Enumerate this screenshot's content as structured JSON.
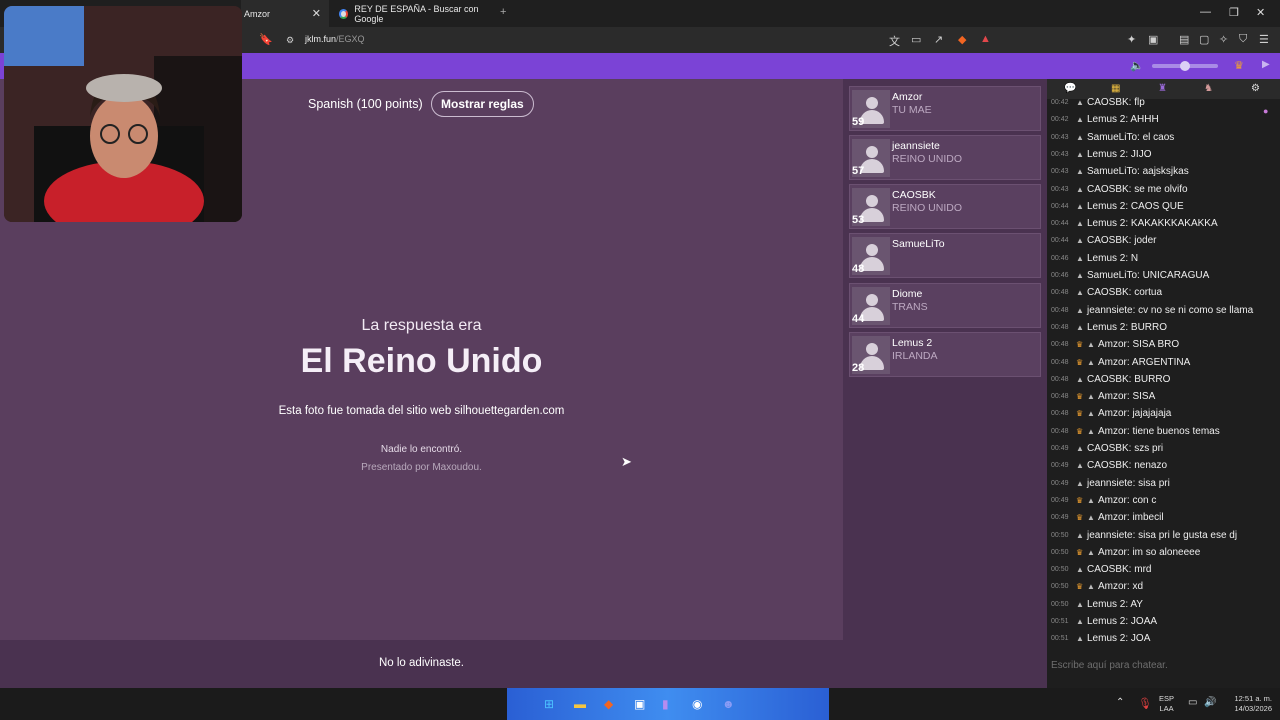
{
  "browser": {
    "tabs": [
      {
        "label": "Amzor"
      },
      {
        "label": "REY DE ESPAÑA - Buscar con Google"
      }
    ],
    "new_tab": "+",
    "url_host": "jklm.fun",
    "url_path": "/EGXQ"
  },
  "game": {
    "language_info": "Spanish (100 points)",
    "rules_button": "Mostrar reglas",
    "answer_intro": "La respuesta era",
    "answer": "El Reino Unido",
    "photo_source": "Esta foto fue tomada del sitio web silhouettegarden.com",
    "nobody_found": "Nadie lo encontró.",
    "presented_by": "Presentado por Maxoudou.",
    "result": "No lo adivinaste."
  },
  "players": [
    {
      "name": "Amzor",
      "guess": "TU MAE",
      "score": "59"
    },
    {
      "name": "jeannsiete",
      "guess": "REINO UNIDO",
      "score": "57"
    },
    {
      "name": "CAOSBK",
      "guess": "REINO UNIDO",
      "score": "53"
    },
    {
      "name": "SamueLiTo",
      "guess": "",
      "score": "48"
    },
    {
      "name": "Diome",
      "guess": "TRANS",
      "score": "44"
    },
    {
      "name": "Lemus 2",
      "guess": "IRLANDA",
      "score": "28"
    }
  ],
  "chat": {
    "messages": [
      {
        "time": "00:42",
        "crown": false,
        "text": "CAOSBK: flp"
      },
      {
        "time": "00:42",
        "crown": false,
        "text": "Lemus 2: AHHH"
      },
      {
        "time": "00:43",
        "crown": false,
        "text": "SamueLiTo: el caos"
      },
      {
        "time": "00:43",
        "crown": false,
        "text": "Lemus 2: JIJO"
      },
      {
        "time": "00:43",
        "crown": false,
        "text": "SamueLiTo: aajsksjkas"
      },
      {
        "time": "00:43",
        "crown": false,
        "text": "CAOSBK: se me olvifo"
      },
      {
        "time": "00:44",
        "crown": false,
        "text": "Lemus 2: CAOS QUE"
      },
      {
        "time": "00:44",
        "crown": false,
        "text": "Lemus 2: KAKAKKKAKAKKA"
      },
      {
        "time": "00:44",
        "crown": false,
        "text": "CAOSBK: joder"
      },
      {
        "time": "00:46",
        "crown": false,
        "text": "Lemus 2: N"
      },
      {
        "time": "00:46",
        "crown": false,
        "text": "SamueLiTo: UNICARAGUA"
      },
      {
        "time": "00:48",
        "crown": false,
        "text": "CAOSBK: cortua"
      },
      {
        "time": "00:48",
        "crown": false,
        "text": "jeannsiete: cv no se ni como se llama"
      },
      {
        "time": "00:48",
        "crown": false,
        "text": "Lemus 2: BURRO"
      },
      {
        "time": "00:48",
        "crown": true,
        "text": "Amzor: SISA BRO"
      },
      {
        "time": "00:48",
        "crown": true,
        "text": "Amzor: ARGENTINA"
      },
      {
        "time": "00:48",
        "crown": false,
        "text": "CAOSBK: BURRO"
      },
      {
        "time": "00:48",
        "crown": true,
        "text": "Amzor: SISA"
      },
      {
        "time": "00:48",
        "crown": true,
        "text": "Amzor: jajajajaja"
      },
      {
        "time": "00:48",
        "crown": true,
        "text": "Amzor: tiene buenos temas"
      },
      {
        "time": "00:49",
        "crown": false,
        "text": "CAOSBK: szs pri"
      },
      {
        "time": "00:49",
        "crown": false,
        "text": "CAOSBK: nenazo"
      },
      {
        "time": "00:49",
        "crown": false,
        "text": "jeannsiete: sisa pri"
      },
      {
        "time": "00:49",
        "crown": true,
        "text": "Amzor: con c"
      },
      {
        "time": "00:49",
        "crown": true,
        "text": "Amzor: imbecil"
      },
      {
        "time": "00:50",
        "crown": false,
        "text": "jeannsiete: sisa pri le gusta ese dj"
      },
      {
        "time": "00:50",
        "crown": true,
        "text": "Amzor: im so aloneeee"
      },
      {
        "time": "00:50",
        "crown": false,
        "text": "CAOSBK: mrd"
      },
      {
        "time": "00:50",
        "crown": true,
        "text": "Amzor: xd"
      },
      {
        "time": "00:50",
        "crown": false,
        "text": "Lemus 2: AY"
      },
      {
        "time": "00:51",
        "crown": false,
        "text": "Lemus 2: JOAA"
      },
      {
        "time": "00:51",
        "crown": false,
        "text": "Lemus 2: JOA"
      }
    ],
    "input_placeholder": "Escribe aquí para chatear."
  },
  "taskbar": {
    "lang_top": "ESP",
    "lang_bottom": "LAA",
    "time": "12:51 a. m.",
    "date": "14/03/2026"
  },
  "colors": {
    "accent": "#7b43d6",
    "game_bg": "#5a3e5e",
    "sidebar_bg": "#4a3250",
    "crown": "#f0a030"
  }
}
